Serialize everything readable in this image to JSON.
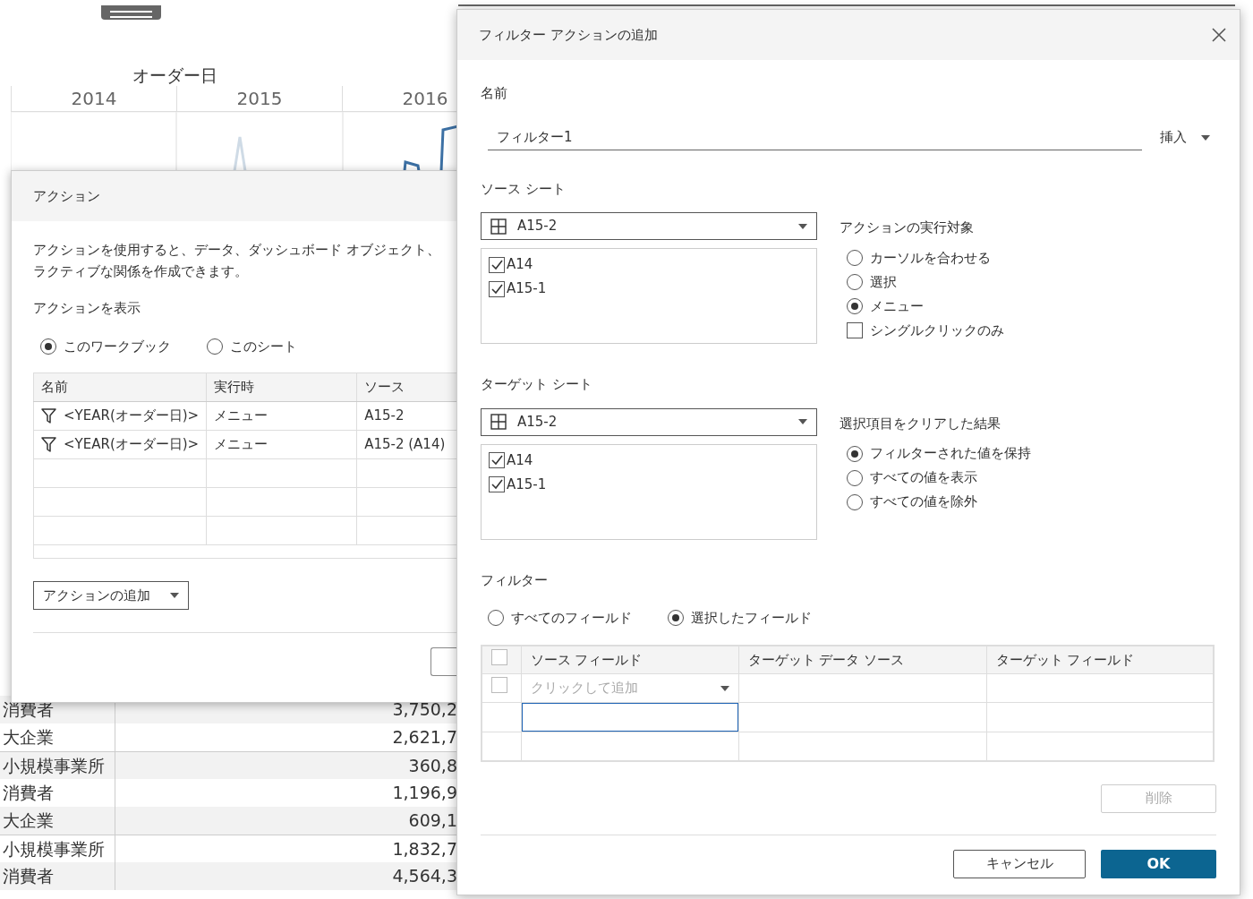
{
  "worksheet": {
    "chart_title": "オーダー日",
    "years": [
      "2014",
      "2015",
      "2016"
    ],
    "rows": [
      {
        "segment": "消費者",
        "value": "3,750,2",
        "group_start": false
      },
      {
        "segment": "大企業",
        "value": "2,621,7",
        "group_start": false
      },
      {
        "segment": "小規模事業所",
        "value": "360,8",
        "group_start": true
      },
      {
        "segment": "消費者",
        "value": "1,196,9",
        "group_start": false
      },
      {
        "segment": "大企業",
        "value": "609,1",
        "group_start": false
      },
      {
        "segment": "小規模事業所",
        "value": "1,832,7",
        "group_start": true
      },
      {
        "segment": "消費者",
        "value": "4,564,3",
        "group_start": false
      }
    ]
  },
  "actions_dialog": {
    "title": "アクション",
    "description_lines": [
      "アクションを使用すると、データ、ダッシュボード オブジェクト、",
      "ラクティブな関係を作成できます。"
    ],
    "show_label": "アクションを表示",
    "scope_options": [
      {
        "label": "このワークブック",
        "selected": true
      },
      {
        "label": "このシート",
        "selected": false
      }
    ],
    "table": {
      "columns": [
        "名前",
        "実行時",
        "ソース"
      ],
      "rows": [
        {
          "name": "<YEAR(オーダー日)>",
          "run_on": "メニュー",
          "source": "A15-2"
        },
        {
          "name": "<YEAR(オーダー日)>",
          "run_on": "メニュー",
          "source": "A15-2 (A14)"
        }
      ]
    },
    "add_button": "アクションの追加"
  },
  "filter_dialog": {
    "title": "フィルター アクションの追加",
    "name_label": "名前",
    "name_value": "フィルター1",
    "insert_button": "挿入",
    "source": {
      "label": "ソース シート",
      "sheet": "A15-2",
      "sheets": [
        {
          "label": "A14",
          "checked": true
        },
        {
          "label": "A15-1",
          "checked": true
        }
      ]
    },
    "run_on": {
      "label": "アクションの実行対象",
      "options": [
        {
          "kind": "radio",
          "label": "カーソルを合わせる",
          "selected": false
        },
        {
          "kind": "radio",
          "label": "選択",
          "selected": false
        },
        {
          "kind": "radio",
          "label": "メニュー",
          "selected": true
        },
        {
          "kind": "checkbox",
          "label": "シングルクリックのみ",
          "checked": false
        }
      ]
    },
    "target": {
      "label": "ターゲット シート",
      "sheet": "A15-2",
      "sheets": [
        {
          "label": "A14",
          "checked": true
        },
        {
          "label": "A15-1",
          "checked": true
        }
      ]
    },
    "clear_result": {
      "label": "選択項目をクリアした結果",
      "options": [
        {
          "kind": "radio",
          "label": "フィルターされた値を保持",
          "selected": true
        },
        {
          "kind": "radio",
          "label": "すべての値を表示",
          "selected": false
        },
        {
          "kind": "radio",
          "label": "すべての値を除外",
          "selected": false
        }
      ]
    },
    "filter": {
      "label": "フィルター",
      "scope": [
        {
          "label": "すべてのフィールド",
          "selected": false
        },
        {
          "label": "選択したフィールド",
          "selected": true
        }
      ],
      "columns": [
        "ソース フィールド",
        "ターゲット データ ソース",
        "ターゲット フィールド"
      ],
      "header_checked": false,
      "add_placeholder": "クリックして追加",
      "add_checked": false
    },
    "delete_button": {
      "label": "削除",
      "disabled": true
    },
    "cancel_button": "キャンセル",
    "ok_button": "OK"
  }
}
